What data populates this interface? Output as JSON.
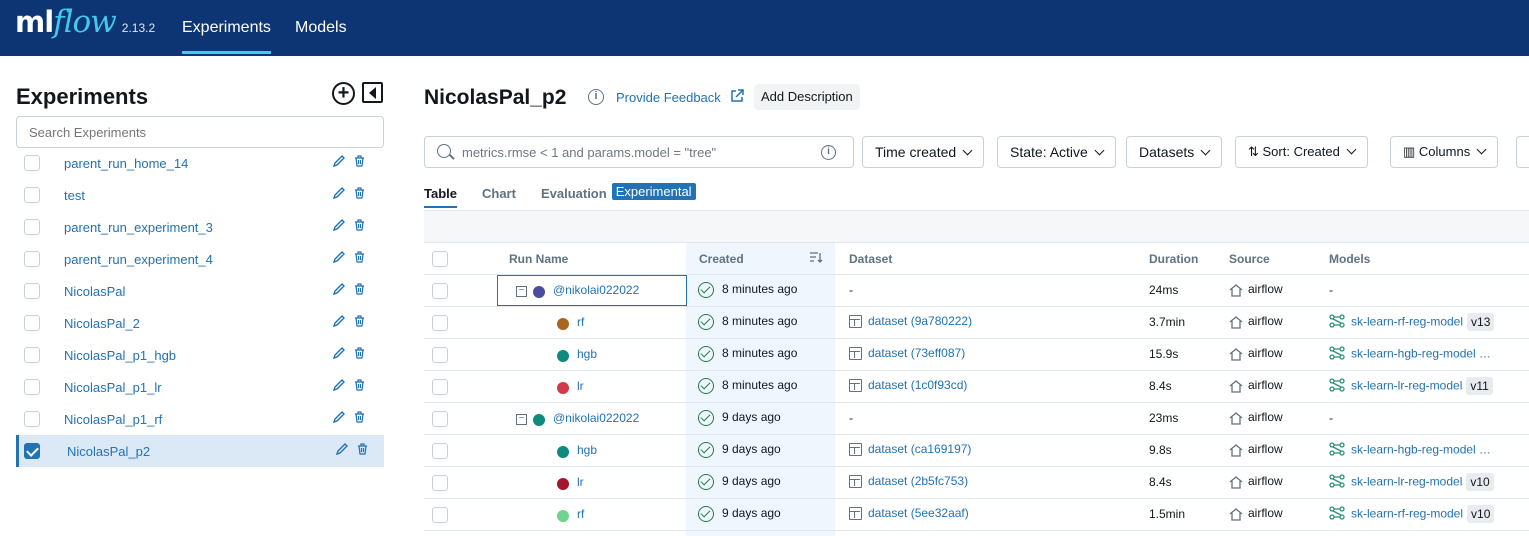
{
  "topbar": {
    "logo_ml": "ml",
    "logo_flow": "flow",
    "version": "2.13.2",
    "nav": [
      {
        "label": "Experiments",
        "active": true
      },
      {
        "label": "Models",
        "active": false
      }
    ]
  },
  "sidebar": {
    "title": "Experiments",
    "search_placeholder": "Search Experiments",
    "experiments": [
      {
        "name": "parent_run_home_14",
        "selected": false
      },
      {
        "name": "test",
        "selected": false
      },
      {
        "name": "parent_run_experiment_3",
        "selected": false
      },
      {
        "name": "parent_run_experiment_4",
        "selected": false
      },
      {
        "name": "NicolasPal",
        "selected": false
      },
      {
        "name": "NicolasPal_2",
        "selected": false
      },
      {
        "name": "NicolasPal_p1_hgb",
        "selected": false
      },
      {
        "name": "NicolasPal_p1_lr",
        "selected": false
      },
      {
        "name": "NicolasPal_p1_rf",
        "selected": false
      },
      {
        "name": "NicolasPal_p2",
        "selected": true
      }
    ]
  },
  "main": {
    "title": "NicolasPal_p2",
    "provide_feedback": "Provide Feedback",
    "add_description": "Add Description",
    "search_placeholder": "metrics.rmse < 1 and params.model = \"tree\"",
    "filters": {
      "time_created": "Time created",
      "state": "State: Active",
      "datasets": "Datasets",
      "sort": "Sort: Created",
      "columns": "Columns"
    },
    "tabs": [
      {
        "label": "Table",
        "active": true
      },
      {
        "label": "Chart",
        "active": false
      },
      {
        "label": "Evaluation",
        "active": false
      }
    ],
    "experimental_badge": "Experimental",
    "columns": {
      "run_name": "Run Name",
      "created": "Created",
      "dataset": "Dataset",
      "duration": "Duration",
      "source": "Source",
      "models": "Models"
    },
    "rows": [
      {
        "name": "@nikolai022022",
        "parent": true,
        "color": "#4b4c9c",
        "created": "8 minutes ago",
        "dataset": "-",
        "duration": "24ms",
        "source": "airflow",
        "model": "-",
        "version": ""
      },
      {
        "name": "rf",
        "parent": false,
        "color": "#a8661f",
        "created": "8 minutes ago",
        "dataset": "dataset (9a780222)",
        "duration": "3.7min",
        "source": "airflow",
        "model": "sk-learn-rf-reg-model",
        "version": "v13"
      },
      {
        "name": "hgb",
        "parent": false,
        "color": "#0e8a7e",
        "created": "8 minutes ago",
        "dataset": "dataset (73eff087)",
        "duration": "15.9s",
        "source": "airflow",
        "model": "sk-learn-hgb-reg-model …",
        "version": ""
      },
      {
        "name": "lr",
        "parent": false,
        "color": "#d13a4b",
        "created": "8 minutes ago",
        "dataset": "dataset (1c0f93cd)",
        "duration": "8.4s",
        "source": "airflow",
        "model": "sk-learn-lr-reg-model",
        "version": "v11"
      },
      {
        "name": "@nikolai022022",
        "parent": true,
        "color": "#0e8a7e",
        "created": "9 days ago",
        "dataset": "-",
        "duration": "23ms",
        "source": "airflow",
        "model": "-",
        "version": ""
      },
      {
        "name": "hgb",
        "parent": false,
        "color": "#0e8a7e",
        "created": "9 days ago",
        "dataset": "dataset (ca169197)",
        "duration": "9.8s",
        "source": "airflow",
        "model": "sk-learn-hgb-reg-model …",
        "version": ""
      },
      {
        "name": "lr",
        "parent": false,
        "color": "#a4162a",
        "created": "9 days ago",
        "dataset": "dataset (2b5fc753)",
        "duration": "8.4s",
        "source": "airflow",
        "model": "sk-learn-lr-reg-model",
        "version": "v10"
      },
      {
        "name": "rf",
        "parent": false,
        "color": "#6fd38f",
        "created": "9 days ago",
        "dataset": "dataset (5ee32aaf)",
        "duration": "1.5min",
        "source": "airflow",
        "model": "sk-learn-rf-reg-model",
        "version": "v10"
      }
    ]
  }
}
